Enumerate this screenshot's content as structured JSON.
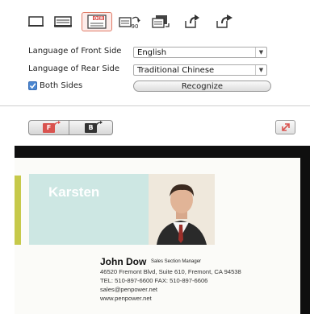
{
  "toolbar": {
    "icons": [
      "frame-icon",
      "scan-frame-icon",
      "ocr-icon",
      "rotate-90-icon",
      "rotate-card-icon",
      "rotate-left-icon",
      "rotate-right-icon"
    ],
    "ocr_label": "OCR",
    "rotate_label": "90"
  },
  "settings": {
    "front_label": "Language of Front Side",
    "front_value": "English",
    "rear_label": "Language of Rear Side",
    "rear_value": "Traditional Chinese",
    "both_sides_label": "Both Sides",
    "both_sides_checked": true,
    "recognize_label": "Recognize"
  },
  "preview": {
    "front_button": "F",
    "back_button": "B",
    "expand_icon": "expand-icon"
  },
  "card": {
    "first_name": "Karsten",
    "name": "John Dow",
    "title": "Sales Section Manager",
    "address": "46520 Fremont Blvd, Suite 610, Fremont, CA 94538",
    "tel_fax": "TEL: 510-897-6600    FAX: 510-897-6606",
    "email": "sales@penpower.net",
    "website": "www.penpower.net"
  },
  "colors": {
    "accent_red": "#d9534f",
    "card_band": "#cde7e3",
    "card_stripe": "#c6c94a"
  }
}
